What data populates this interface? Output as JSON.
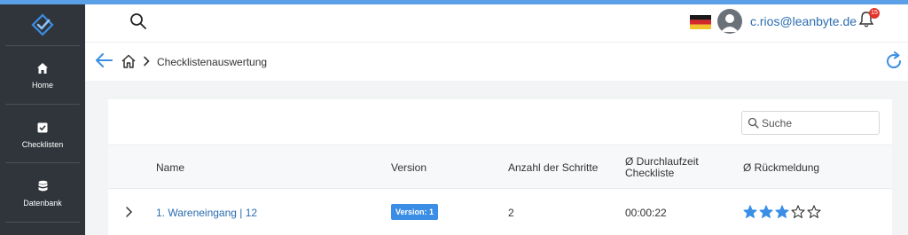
{
  "header": {
    "user_email": "c.rios@leanbyte.de",
    "notification_count": "15",
    "language": "Deutsch"
  },
  "sidebar": {
    "items": [
      {
        "label": "Home",
        "icon": "home-icon"
      },
      {
        "label": "Checklisten",
        "icon": "checkbox-icon"
      },
      {
        "label": "Datenbank",
        "icon": "database-icon"
      }
    ]
  },
  "breadcrumb": {
    "current": "Checklistenauswertung"
  },
  "search": {
    "placeholder": "Suche"
  },
  "table": {
    "columns": [
      "Name",
      "Version",
      "Anzahl der Schritte",
      "Ø Durchlaufzeit Checkliste",
      "Ø Rückmeldung"
    ],
    "col_duration_line1": "Ø Durchlaufzeit",
    "col_duration_line2": "Checkliste",
    "rows": [
      {
        "name": "1. Wareneingang | 12",
        "version": "Version: 1",
        "steps": "2",
        "duration": "00:00:22",
        "rating": 3,
        "rating_max": 5
      }
    ]
  },
  "colors": {
    "accent": "#3a8ee6",
    "link": "#2b6cb0",
    "sidebar_bg": "#2f353b",
    "badge_red": "#e0342b"
  }
}
